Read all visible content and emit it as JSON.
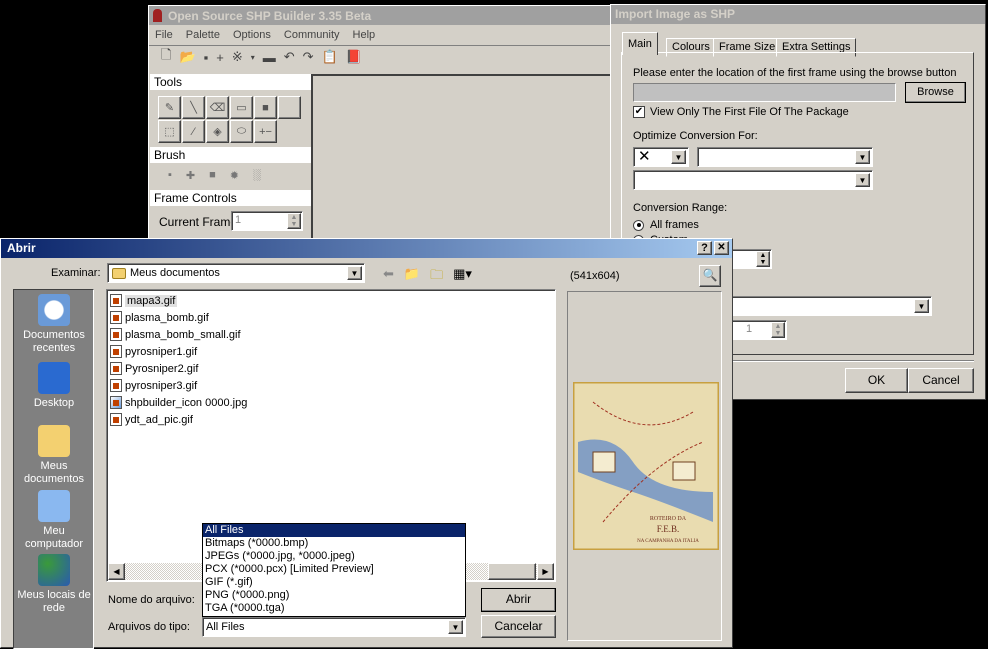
{
  "shp_window": {
    "title": "Open Source SHP Builder 3.35 Beta",
    "menu": [
      "File",
      "Palette",
      "Options",
      "Community",
      "Help"
    ],
    "toolbar_icons": [
      "new-icon",
      "open-icon",
      "save-icon",
      "plus-icon",
      "pattern-icon",
      "dropdown-icon",
      "minus-icon",
      "undo-icon",
      "redo-icon",
      "properties-icon",
      "help-book-icon"
    ],
    "sections": {
      "tools": "Tools",
      "brush": "Brush",
      "frame_controls": "Frame Controls"
    },
    "current_frame_label": "Current Frame",
    "current_frame_value": "1"
  },
  "import_dialog": {
    "title": "Import Image as SHP",
    "tabs": [
      "Main",
      "Colours",
      "Frame Size",
      "Extra Settings"
    ],
    "active_tab": "Main",
    "location_label": "Please enter the location of the first frame using the browse button",
    "location_value": "",
    "browse": "Browse",
    "view_first_checkbox": "View Only The First File Of The Package",
    "view_first_checked": true,
    "optimize_label": "Optimize Conversion For:",
    "optimize_icon_value": "✕",
    "conversion_range_label": "Conversion Range:",
    "radio_all": "All frames",
    "radio_custom": "Custom",
    "spin_value": "1",
    "ok": "OK",
    "cancel": "Cancel"
  },
  "open_dialog": {
    "title": "Abrir",
    "help": "?",
    "close": "✕",
    "look_in_label": "Examinar:",
    "look_in_value": "Meus documentos",
    "places": [
      "Documentos recentes",
      "Desktop",
      "Meus documentos",
      "Meu computador",
      "Meus locais de rede"
    ],
    "files": [
      "mapa3.gif",
      "plasma_bomb.gif",
      "plasma_bomb_small.gif",
      "pyrosniper1.gif",
      "Pyrosniper2.gif",
      "pyrosniper3.gif",
      "shpbuilder_icon 0000.jpg",
      "ydt_ad_pic.gif"
    ],
    "selected_file": "mapa3.gif",
    "filename_label": "Nome do arquivo:",
    "filetype_label": "Arquivos do tipo:",
    "filetype_value": "All Files",
    "filetype_options": [
      "All Files",
      "Bitmaps (*0000.bmp)",
      "JPEGs (*0000.jpg, *0000.jpeg)",
      "PCX (*0000.pcx) [Limited Preview]",
      "GIF (*.gif)",
      "PNG (*0000.png)",
      "TGA (*0000.tga)"
    ],
    "open_button": "Abrir",
    "cancel_button": "Cancelar",
    "preview_size": "(541x604)",
    "preview_map_text": [
      "ROTEIRO",
      "DA",
      "F.E.B.",
      "NA CAMPANHA DA ITALIA"
    ]
  },
  "colors": {
    "active_title_start": "#0a246a",
    "active_title_end": "#a6caf0",
    "inactive_title": "#a0a0a0",
    "face": "#d4d0c8",
    "places_bar": "#808080"
  }
}
